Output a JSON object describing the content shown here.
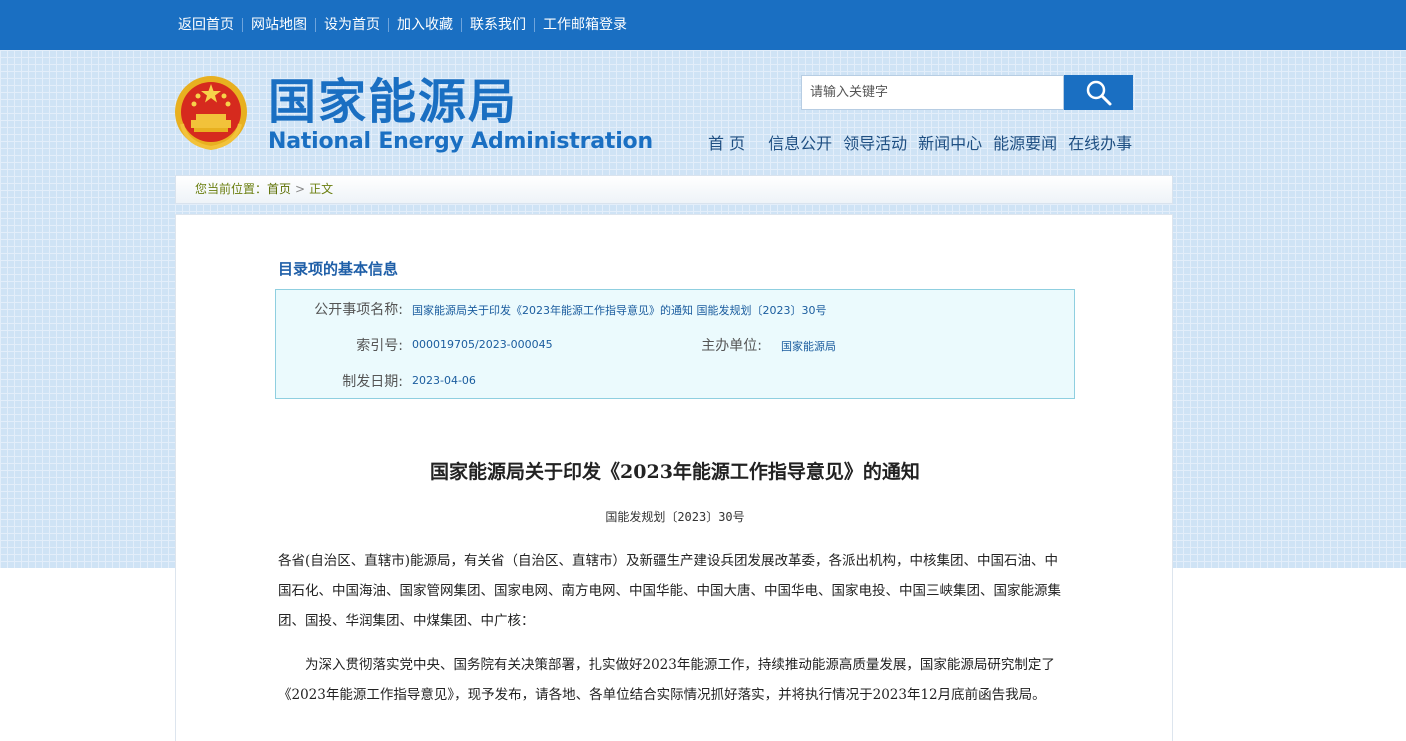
{
  "top_links": [
    "返回首页",
    "网站地图",
    "设为首页",
    "加入收藏",
    "联系我们",
    "工作邮箱登录"
  ],
  "logo": {
    "cn": "国家能源局",
    "en": "National Energy Administration"
  },
  "search": {
    "placeholder": "请输入关键字"
  },
  "main_nav": [
    "首 页",
    "信息公开",
    "领导活动",
    "新闻中心",
    "能源要闻",
    "在线办事"
  ],
  "breadcrumb": {
    "prefix": "您当前位置：",
    "home": "首页",
    "current": "正文"
  },
  "info": {
    "heading": "目录项的基本信息",
    "name_label": "公开事项名称:",
    "name_value": "国家能源局关于印发《2023年能源工作指导意见》的通知 国能发规划〔2023〕30号",
    "index_label": "索引号:",
    "index_value": "000019705/2023-000045",
    "org_label": "主办单位:",
    "org_value": "国家能源局",
    "date_label": "制发日期:",
    "date_value": "2023-04-06"
  },
  "document": {
    "title": "国家能源局关于印发《2023年能源工作指导意见》的通知",
    "number": "国能发规划〔2023〕30号",
    "para1": "各省(自治区、直辖市)能源局，有关省（自治区、直辖市）及新疆生产建设兵团发展改革委，各派出机构，中核集团、中国石油、中国石化、中国海油、国家管网集团、国家电网、南方电网、中国华能、中国大唐、中国华电、国家电投、中国三峡集团、国家能源集团、国投、华润集团、中煤集团、中广核：",
    "para2": "为深入贯彻落实党中央、国务院有关决策部署，扎实做好2023年能源工作，持续推动能源高质量发展，国家能源局研究制定了《2023年能源工作指导意见》，现予发布，请各地、各单位结合实际情况抓好落实，并将执行情况于2023年12月底前函告我局。"
  }
}
